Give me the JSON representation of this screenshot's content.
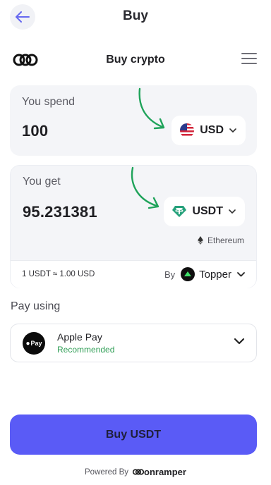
{
  "topbar": {
    "title": "Buy"
  },
  "header": {
    "title": "Buy crypto"
  },
  "spend": {
    "label": "You spend",
    "amount": "100",
    "currency": "USD"
  },
  "get": {
    "label": "You get",
    "amount": "95.231381",
    "currency": "USDT",
    "network": "Ethereum",
    "rate": "1 USDT ≈ 1.00 USD",
    "provider_prefix": "By",
    "provider": "Topper"
  },
  "payment": {
    "section_label": "Pay using",
    "method": "Apple Pay",
    "note": "Recommended",
    "icon_text": "Pay"
  },
  "cta": {
    "label": "Buy USDT"
  },
  "footer": {
    "powered_by": "Powered By",
    "brand": "onramper"
  },
  "colors": {
    "accent": "#5a5bf6",
    "recommended": "#2f9e55",
    "arrow": "#1fa35a",
    "tether": "#26a17b"
  },
  "icons": [
    "back-arrow-icon",
    "onramper-logo-icon",
    "hamburger-menu-icon",
    "us-flag-icon",
    "tether-icon",
    "ethereum-icon",
    "topper-icon",
    "chevron-down-icon",
    "apple-pay-icon"
  ]
}
